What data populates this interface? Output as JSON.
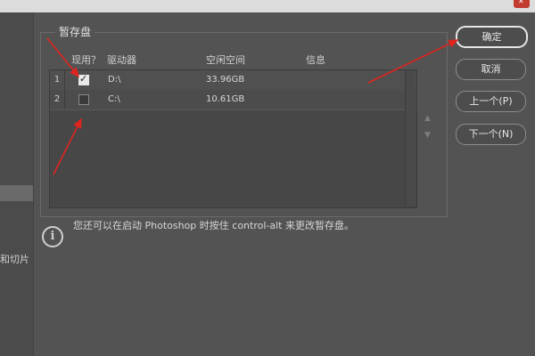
{
  "scratch_disks": {
    "group_title": "暂存盘",
    "columns": {
      "active": "现用？",
      "drive": "驱动器",
      "free_space": "空闲空间",
      "info": "信息"
    },
    "rows": [
      {
        "index": "1",
        "checked": true,
        "drive": "D:\\",
        "free_space": "33.96GB",
        "info": ""
      },
      {
        "index": "2",
        "checked": false,
        "drive": "C:\\",
        "free_space": "10.61GB",
        "info": ""
      }
    ]
  },
  "buttons": {
    "ok": "确定",
    "cancel": "取消",
    "prev": "上一个(P)",
    "next": "下一个(N)"
  },
  "left_panel": {
    "partial_label": "和切片"
  },
  "info": {
    "icon": "info-icon",
    "text": "您还可以在启动 Photoshop 时按住 control-alt 来更改暂存盘。"
  },
  "reorder": {
    "up_glyph": "▲",
    "down_glyph": "▼"
  },
  "colors": {
    "background": "#535353",
    "annotation_arrow": "#e0241f"
  }
}
